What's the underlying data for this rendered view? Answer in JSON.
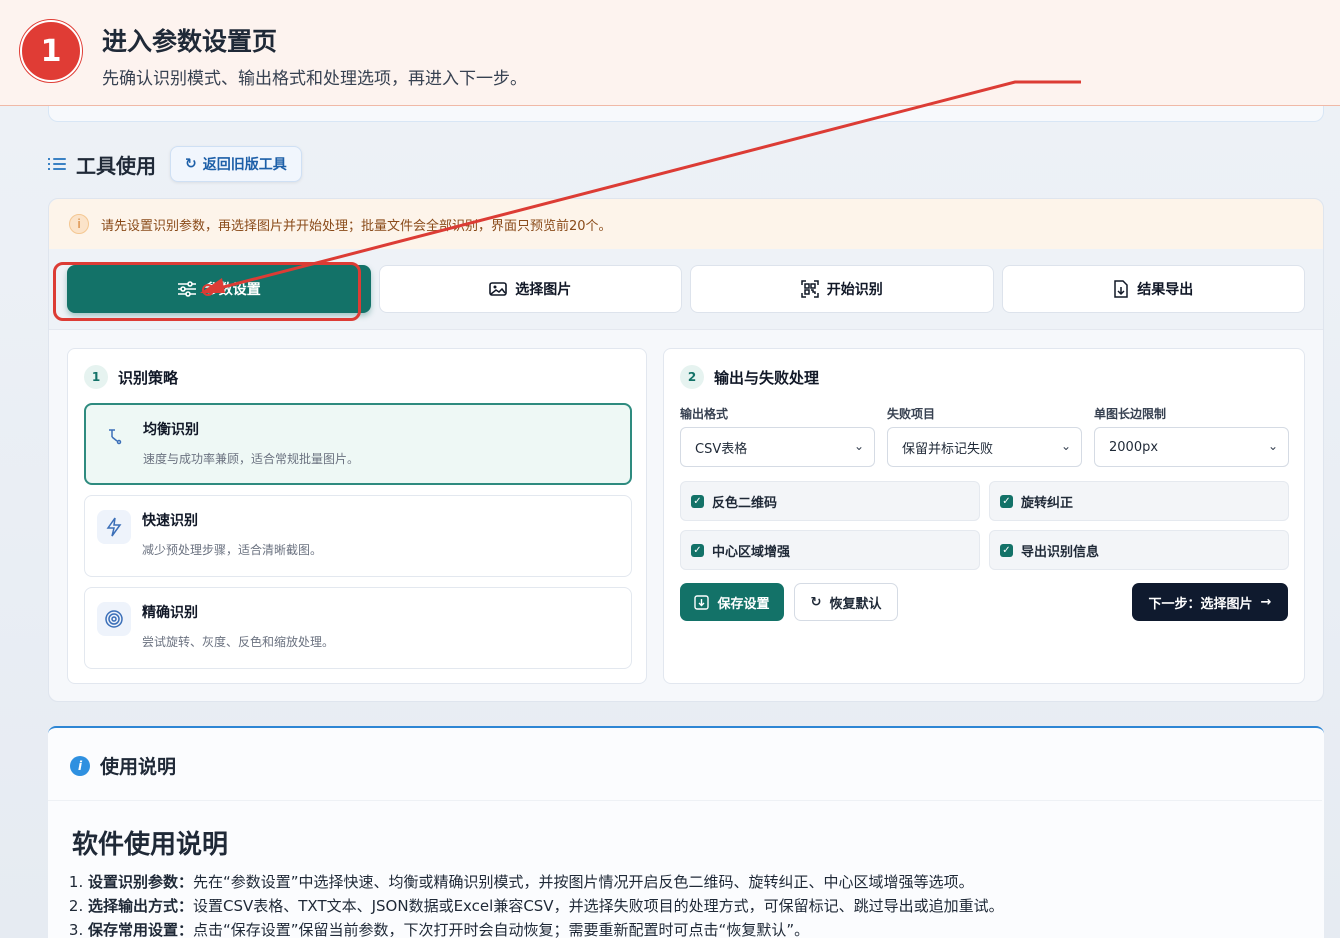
{
  "banner": {
    "step_number": "1",
    "title": "进入参数设置页",
    "subtitle": "先确认识别模式、输出格式和处理选项，再进入下一步。"
  },
  "tool_header": {
    "title": "工具使用",
    "back_button": "返回旧版工具"
  },
  "notice": {
    "icon": "info-circle-icon",
    "text": "请先设置识别参数，再选择图片并开始处理；批量文件会全部识别，界面只预览前20个。"
  },
  "steps": [
    {
      "label": "参数设置",
      "icon": "sliders-icon"
    },
    {
      "label": "选择图片",
      "icon": "image-icon"
    },
    {
      "label": "开始识别",
      "icon": "qr-scan-icon"
    },
    {
      "label": "结果导出",
      "icon": "file-export-icon"
    }
  ],
  "strategy": {
    "number": "1",
    "title": "识别策略",
    "modes": [
      {
        "title": "均衡识别",
        "desc": "速度与成功率兼顾，适合常规批量图片。",
        "icon": "balance-icon"
      },
      {
        "title": "快速识别",
        "desc": "减少预处理步骤，适合清晰截图。",
        "icon": "bolt-icon"
      },
      {
        "title": "精确识别",
        "desc": "尝试旋转、灰度、反色和缩放处理。",
        "icon": "target-icon"
      }
    ]
  },
  "output": {
    "number": "2",
    "title": "输出与失败处理",
    "fields": [
      {
        "label": "输出格式",
        "value": "CSV表格"
      },
      {
        "label": "失败项目",
        "value": "保留并标记失败"
      },
      {
        "label": "单图长边限制",
        "value": "2000px"
      }
    ],
    "checkboxes": [
      {
        "label": "反色二维码",
        "checked": true
      },
      {
        "label": "旋转纠正",
        "checked": true
      },
      {
        "label": "中心区域增强",
        "checked": true
      },
      {
        "label": "导出识别信息",
        "checked": true
      }
    ],
    "save_button": "保存设置",
    "reset_button": "恢复默认",
    "next_button": "下一步：选择图片"
  },
  "usage": {
    "header": "使用说明",
    "title": "软件使用说明",
    "items": [
      {
        "bold": "设置识别参数：",
        "text": "先在“参数设置”中选择快速、均衡或精确识别模式，并按图片情况开启反色二维码、旋转纠正、中心区域增强等选项。"
      },
      {
        "bold": "选择输出方式：",
        "text": "设置CSV表格、TXT文本、JSON数据或Excel兼容CSV，并选择失败项目的处理方式，可保留标记、跳过导出或追加重试。"
      },
      {
        "bold": "保存常用设置：",
        "text": "点击“保存设置”保留当前参数，下次打开时会自动恢复；需要重新配置时可点击“恢复默认”。"
      }
    ]
  },
  "colors": {
    "accent": "#137268",
    "annotation_red": "#dc3c35",
    "dark_button": "#0f1a2e"
  }
}
